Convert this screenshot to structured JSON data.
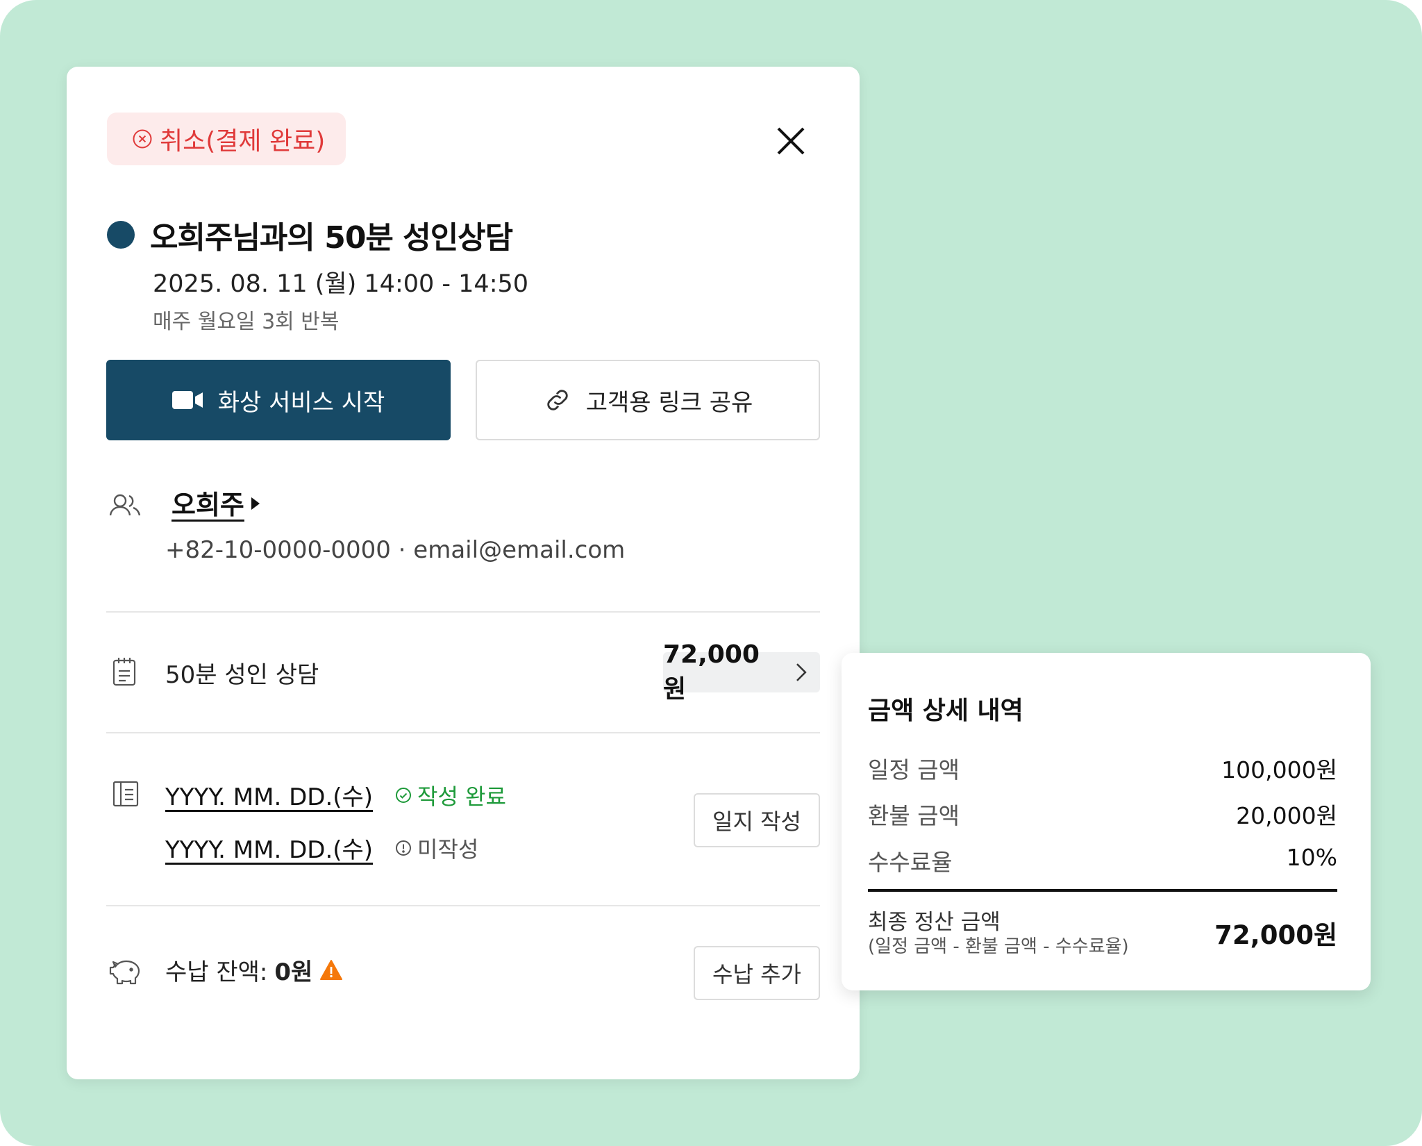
{
  "status_badge": {
    "label": "취소(결제 완료)",
    "color": "#e03a3a",
    "background": "#fdebeb"
  },
  "appointment": {
    "title": "오희주님과의 50분 성인상담",
    "datetime": "2025. 08. 11 (월) 14:00 - 14:50",
    "repeat": "매주 월요일 3회 반복",
    "accent_color": "#174a66"
  },
  "actions": {
    "video_start": "화상 서비스 시작",
    "share_link": "고객용 링크 공유"
  },
  "customer": {
    "name": "오희주",
    "contact": "+82-10-0000-0000 · email@email.com"
  },
  "service": {
    "name": "50분 성인 상담",
    "price": "72,000원"
  },
  "journals": [
    {
      "date": "YYYY. MM. DD.(수)",
      "status": "작성 완료",
      "status_color": "#1e9a3a"
    },
    {
      "date": "YYYY. MM. DD.(수)",
      "status": "미작성",
      "status_color": "#555555"
    }
  ],
  "journal_button": "일지 작성",
  "payment": {
    "balance_label": "수납 잔액:",
    "balance_value": "0원",
    "add_button": "수납 추가",
    "warning_color": "#f5780a"
  },
  "price_detail": {
    "title": "금액 상세 내역",
    "rows": [
      {
        "label": "일정 금액",
        "value": "100,000원"
      },
      {
        "label": "환불 금액",
        "value": "20,000원"
      },
      {
        "label": "수수료율",
        "value": "10%"
      }
    ],
    "final_label": "최종 정산 금액",
    "final_formula": "(일정 금액 - 환불 금액 - 수수료율)",
    "final_value": "72,000원"
  },
  "icons": {
    "close": "close-icon",
    "video": "video-camera-icon",
    "link": "link-icon",
    "customer": "users-icon",
    "service": "notepad-icon",
    "journal": "journal-icon",
    "payment": "piggy-bank-icon",
    "warning": "warning-triangle-icon"
  }
}
